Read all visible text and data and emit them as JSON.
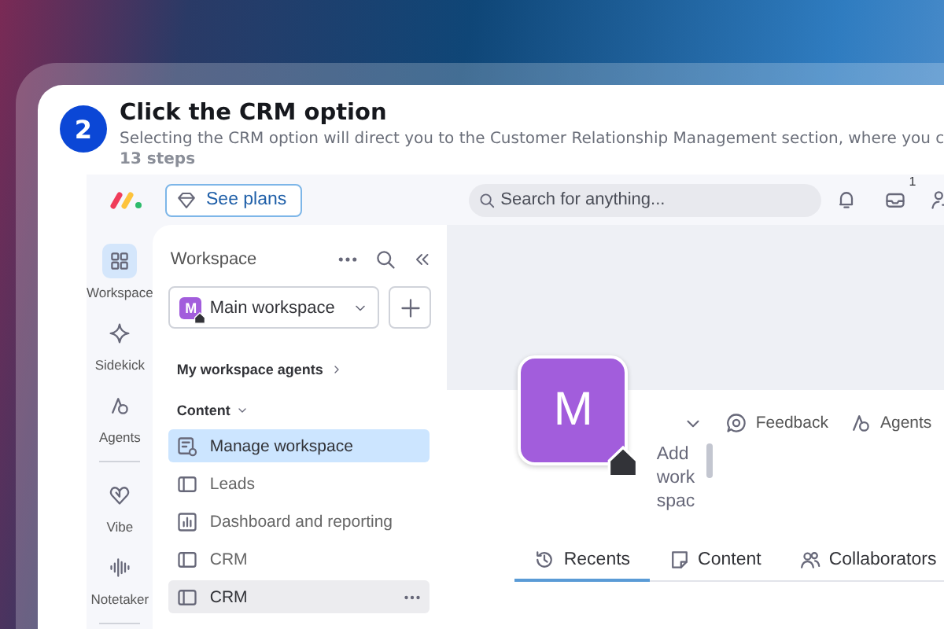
{
  "step": {
    "number": "2",
    "title": "Click the CRM option",
    "description": "Selecting the CRM option will direct you to the Customer Relationship Management section, where you c",
    "steps_count": "13 steps"
  },
  "topbar": {
    "plans_button": "See plans",
    "search_placeholder": "Search for anything...",
    "inbox_badge": "1"
  },
  "rail": [
    {
      "label": "Workspace",
      "kind": "grid",
      "selected": true
    },
    {
      "label": "Sidekick",
      "kind": "sparkle",
      "selected": false
    },
    {
      "label": "Agents",
      "kind": "agents",
      "selected": false
    },
    {
      "label": "Vibe",
      "kind": "heart",
      "selected": false
    },
    {
      "label": "Notetaker",
      "kind": "wave",
      "selected": false
    }
  ],
  "sidebar": {
    "title": "Workspace",
    "workspace_select": "Main workspace",
    "workspace_letter": "M",
    "agents_link": "My workspace agents",
    "section": "Content",
    "items": [
      {
        "label": "Manage workspace",
        "kind": "manage",
        "selected": true,
        "hovered": false
      },
      {
        "label": "Leads",
        "kind": "board",
        "selected": false,
        "hovered": false
      },
      {
        "label": "Dashboard and reporting",
        "kind": "dashboard",
        "selected": false,
        "hovered": false
      },
      {
        "label": "CRM",
        "kind": "board",
        "selected": false,
        "hovered": false
      },
      {
        "label": "CRM",
        "kind": "board",
        "selected": false,
        "hovered": true
      }
    ]
  },
  "main": {
    "avatar_letter": "M",
    "description_hint": "Add workspac",
    "actions": [
      {
        "label": "Feedback",
        "kind": "feedback"
      },
      {
        "label": "Agents",
        "kind": "agents"
      }
    ],
    "tabs": [
      {
        "label": "Recents",
        "kind": "recent",
        "selected": true
      },
      {
        "label": "Content",
        "kind": "content",
        "selected": false
      },
      {
        "label": "Collaborators",
        "kind": "people",
        "selected": false
      }
    ]
  }
}
